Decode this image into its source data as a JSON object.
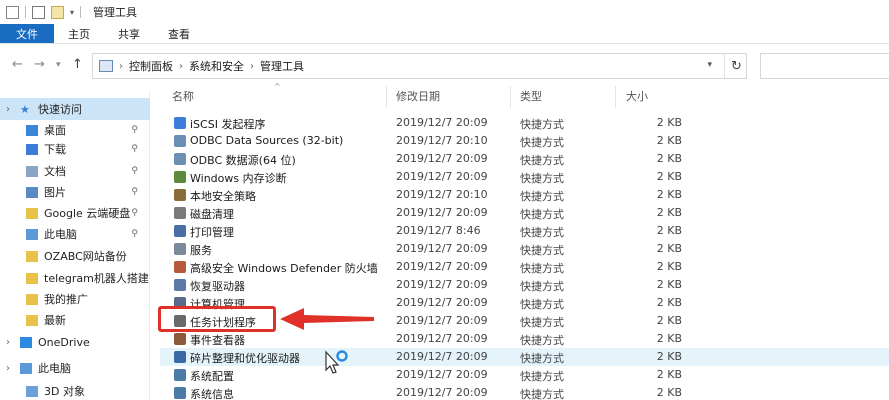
{
  "window": {
    "title": "管理工具"
  },
  "ribbon": {
    "tabs": [
      "文件",
      "主页",
      "共享",
      "查看"
    ]
  },
  "address": {
    "crumbs": [
      "控制面板",
      "系统和安全",
      "管理工具"
    ]
  },
  "sidebar": {
    "items": [
      {
        "label": "快速访问",
        "icon": "star-icon",
        "pinned": false
      },
      {
        "label": "桌面",
        "icon": "desktop-icon",
        "pinned": true
      },
      {
        "label": "下载",
        "icon": "download-icon",
        "pinned": true
      },
      {
        "label": "文档",
        "icon": "document-icon",
        "pinned": true
      },
      {
        "label": "图片",
        "icon": "picture-icon",
        "pinned": true
      },
      {
        "label": "Google 云端硬盘",
        "icon": "folder-icon",
        "pinned": true
      },
      {
        "label": "此电脑",
        "icon": "computer-icon",
        "pinned": true
      },
      {
        "label": "OZABC网站备份",
        "icon": "folder-icon",
        "pinned": false
      },
      {
        "label": "telegram机器人搭建",
        "icon": "folder-icon",
        "pinned": false
      },
      {
        "label": "我的推广",
        "icon": "folder-icon",
        "pinned": false
      },
      {
        "label": "最新",
        "icon": "folder-icon",
        "pinned": false
      },
      {
        "label": "OneDrive",
        "icon": "cloud-icon",
        "pinned": false
      },
      {
        "label": "此电脑",
        "icon": "computer-icon",
        "pinned": false
      },
      {
        "label": "3D 对象",
        "icon": "cube-icon",
        "pinned": false
      }
    ]
  },
  "columns": {
    "name": "名称",
    "date": "修改日期",
    "type": "类型",
    "size": "大小"
  },
  "files": [
    {
      "name": "iSCSI 发起程序",
      "date": "2019/12/7 20:09",
      "type": "快捷方式",
      "size": "2 KB",
      "color": "#3b7dd8"
    },
    {
      "name": "ODBC Data Sources (32-bit)",
      "date": "2019/12/7 20:10",
      "type": "快捷方式",
      "size": "2 KB",
      "color": "#6b8fb5"
    },
    {
      "name": "ODBC 数据源(64 位)",
      "date": "2019/12/7 20:09",
      "type": "快捷方式",
      "size": "2 KB",
      "color": "#6b8fb5"
    },
    {
      "name": "Windows 内存诊断",
      "date": "2019/12/7 20:09",
      "type": "快捷方式",
      "size": "2 KB",
      "color": "#5a8a3a"
    },
    {
      "name": "本地安全策略",
      "date": "2019/12/7 20:10",
      "type": "快捷方式",
      "size": "2 KB",
      "color": "#8a6b3a"
    },
    {
      "name": "磁盘清理",
      "date": "2019/12/7 20:09",
      "type": "快捷方式",
      "size": "2 KB",
      "color": "#7a7a7a"
    },
    {
      "name": "打印管理",
      "date": "2019/12/7 8:46",
      "type": "快捷方式",
      "size": "2 KB",
      "color": "#4a6fa5"
    },
    {
      "name": "服务",
      "date": "2019/12/7 20:09",
      "type": "快捷方式",
      "size": "2 KB",
      "color": "#7a8a9a"
    },
    {
      "name": "高级安全 Windows Defender 防火墙",
      "date": "2019/12/7 20:09",
      "type": "快捷方式",
      "size": "2 KB",
      "color": "#b55a3a"
    },
    {
      "name": "恢复驱动器",
      "date": "2019/12/7 20:09",
      "type": "快捷方式",
      "size": "2 KB",
      "color": "#5a7aa5"
    },
    {
      "name": "计算机管理",
      "date": "2019/12/7 20:09",
      "type": "快捷方式",
      "size": "2 KB",
      "color": "#5a6a8a"
    },
    {
      "name": "任务计划程序",
      "date": "2019/12/7 20:09",
      "type": "快捷方式",
      "size": "2 KB",
      "color": "#6a6a6a"
    },
    {
      "name": "事件查看器",
      "date": "2019/12/7 20:09",
      "type": "快捷方式",
      "size": "2 KB",
      "color": "#8a5a3a"
    },
    {
      "name": "碎片整理和优化驱动器",
      "date": "2019/12/7 20:09",
      "type": "快捷方式",
      "size": "2 KB",
      "color": "#3a6aa5"
    },
    {
      "name": "系统配置",
      "date": "2019/12/7 20:09",
      "type": "快捷方式",
      "size": "2 KB",
      "color": "#4a7aa5"
    },
    {
      "name": "系统信息",
      "date": "2019/12/7 20:09",
      "type": "快捷方式",
      "size": "2 KB",
      "color": "#4a7aa5"
    }
  ],
  "colors": {
    "accent": "#1a6cc2",
    "annotation": "#e0302a"
  }
}
